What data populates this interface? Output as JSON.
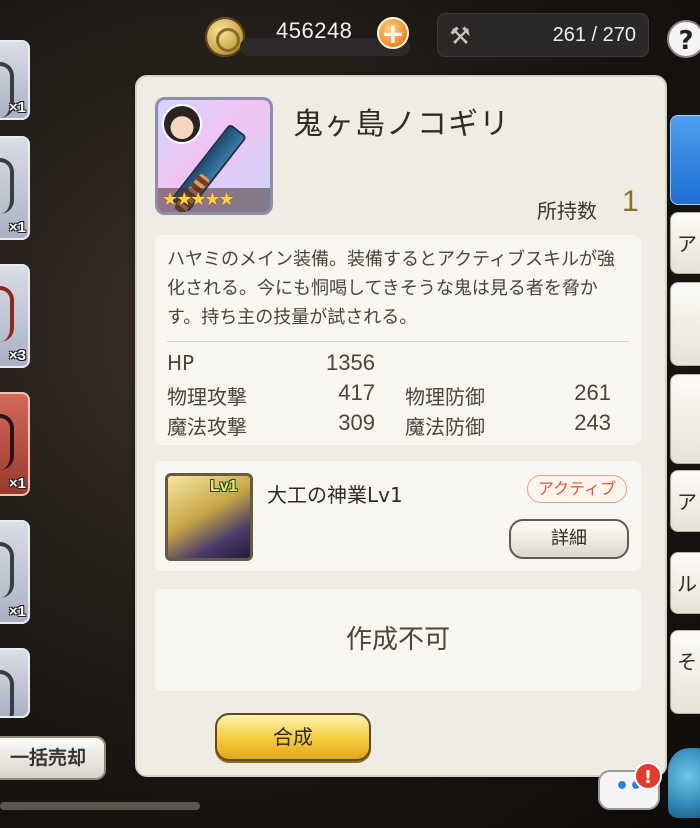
{
  "topbar": {
    "gil": "456248",
    "inventory": "261 / 270",
    "help": "?"
  },
  "left_list": {
    "quantities": [
      "×1",
      "×1",
      "×3",
      "×1",
      "×1"
    ],
    "bulk_sell": "一括売却"
  },
  "right_tabs": [
    "",
    "ア",
    "",
    "",
    "ア",
    "ル",
    "そ"
  ],
  "item": {
    "name": "鬼ヶ島ノコギリ",
    "stars": "★★★★★",
    "owned_label": "所持数",
    "owned_count": "1",
    "description": "ハヤミのメイン装備。装備するとアクティブスキルが強化される。今にも恫喝してきそうな鬼は見る者を脅かす。持ち主の技量が試される。",
    "stats": {
      "hp_label": "HP",
      "hp": "1356",
      "patk_label": "物理攻撃",
      "patk": "417",
      "pdef_label": "物理防御",
      "pdef": "261",
      "matk_label": "魔法攻撃",
      "matk": "309",
      "mdef_label": "魔法防御",
      "mdef": "243"
    }
  },
  "skill": {
    "level_badge": "Lv1",
    "name": "大工の神業Lv1",
    "type": "アクティブ",
    "detail_button": "詳細"
  },
  "craft": {
    "status": "作成不可",
    "compose_button": "合成"
  },
  "chat": {
    "bubble": "••",
    "alert": "!"
  },
  "colors": {
    "panel": "#efece4",
    "owned_value": "#8c6b3b",
    "active_badge": "#e2553a",
    "compose_button": "#f5cb3c"
  }
}
